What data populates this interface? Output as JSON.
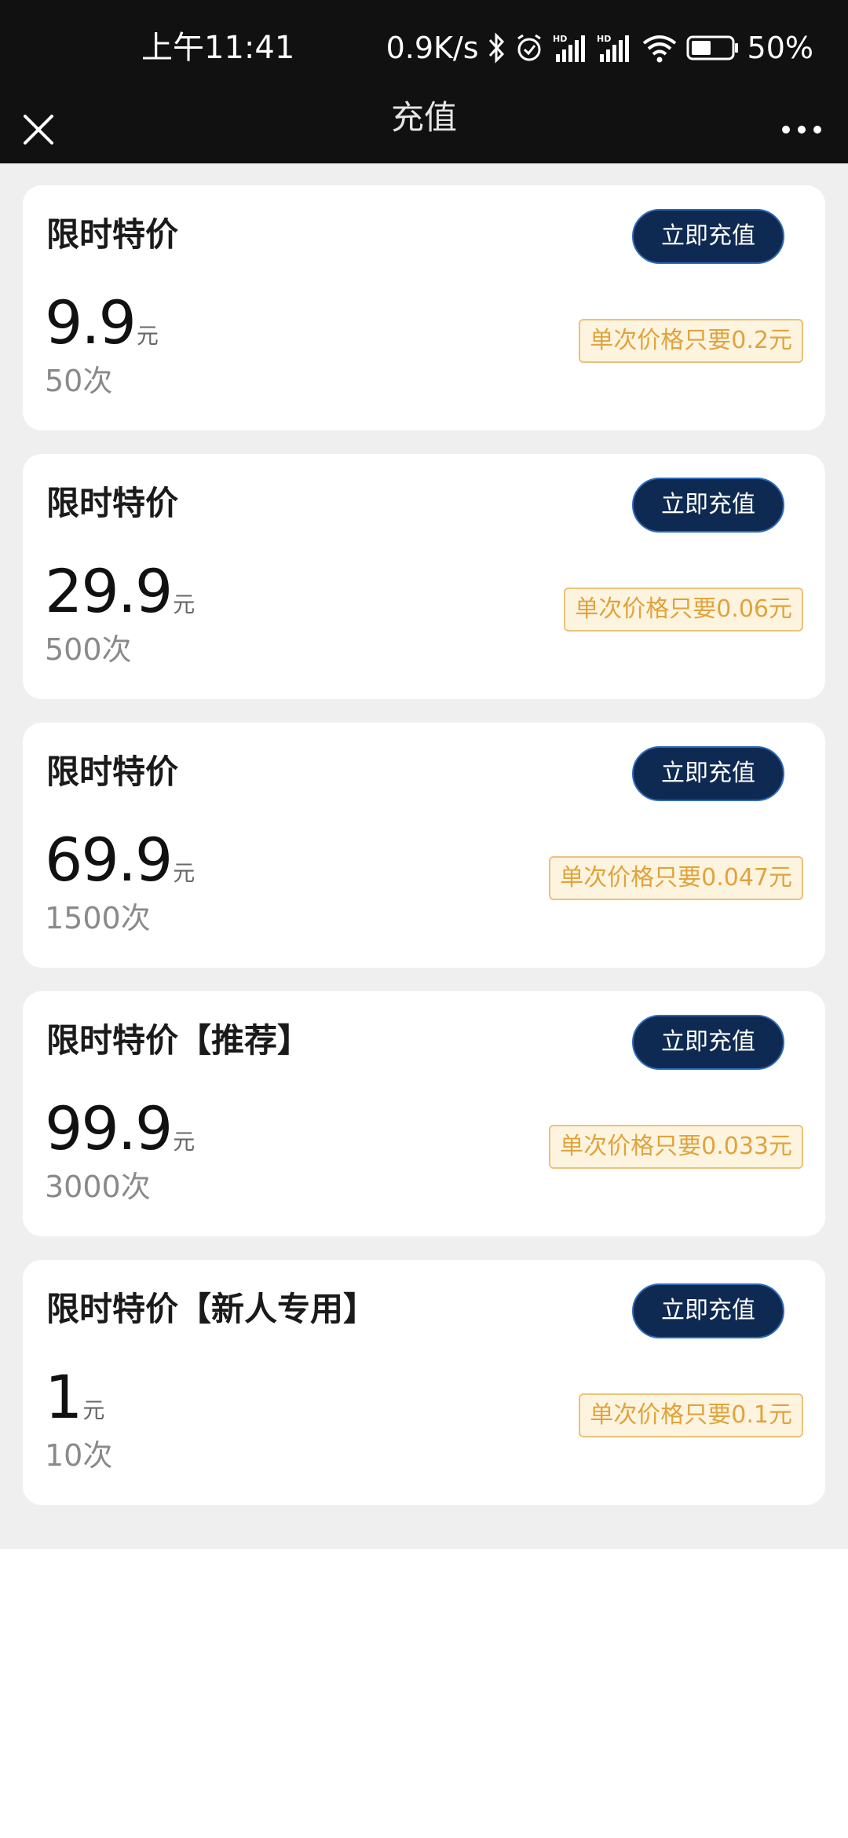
{
  "status_bar": {
    "time": "上午11:41",
    "network_speed": "0.9K/s",
    "battery": "50%",
    "icons": [
      "bluetooth-icon",
      "alarm-icon",
      "hd-signal-icon",
      "hd-signal-icon",
      "wifi-icon",
      "battery-icon"
    ]
  },
  "nav": {
    "title": "充值",
    "close_icon": "close-icon",
    "more_icon": "more-icon"
  },
  "colors": {
    "button_bg": "#0f2a52",
    "badge_text": "#e1a33b",
    "badge_border": "#eac27a",
    "page_bg": "#efefef"
  },
  "plans": [
    {
      "title": "限时特价",
      "button_label": "立即充值",
      "price": "9.9",
      "unit": "元",
      "count": "50次",
      "unit_price": "单次价格只要0.2元"
    },
    {
      "title": "限时特价",
      "button_label": "立即充值",
      "price": "29.9",
      "unit": "元",
      "count": "500次",
      "unit_price": "单次价格只要0.06元"
    },
    {
      "title": "限时特价",
      "button_label": "立即充值",
      "price": "69.9",
      "unit": "元",
      "count": "1500次",
      "unit_price": "单次价格只要0.047元"
    },
    {
      "title": "限时特价【推荐】",
      "button_label": "立即充值",
      "price": "99.9",
      "unit": "元",
      "count": "3000次",
      "unit_price": "单次价格只要0.033元"
    },
    {
      "title": "限时特价【新人专用】",
      "button_label": "立即充值",
      "price": "1",
      "unit": "元",
      "count": "10次",
      "unit_price": "单次价格只要0.1元"
    }
  ]
}
